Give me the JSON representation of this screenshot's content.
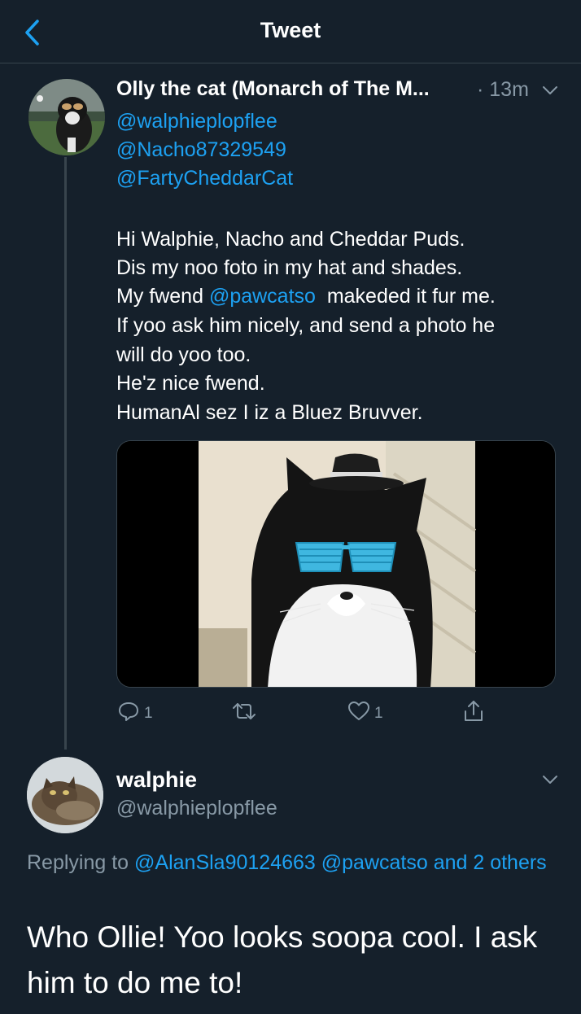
{
  "header": {
    "title": "Tweet"
  },
  "tweet": {
    "author_name": "Olly the cat (Monarch of The M...",
    "time": "· 13m",
    "reply_handles": [
      "@walphieplopflee",
      "@Nacho87329549",
      "@FartyCheddarCat"
    ],
    "body": {
      "line1": "Hi Walphie, Nacho and Cheddar Puds.",
      "line2": "Dis my noo foto in my hat and shades.",
      "line3_before": "My fwend ",
      "line3_mention": "@pawcatso",
      "line3_after": "  makeded it fur me.",
      "line4": "If yoo ask him nicely, and send a photo he",
      "line5": "will do yoo too.",
      "line6": "He'z nice fwend.",
      "line7": "HumanAl sez I iz a Bluez Bruvver."
    },
    "actions": {
      "reply_count": "1",
      "retweet_count": "",
      "like_count": "1"
    }
  },
  "reply": {
    "name": "walphie",
    "handle": "@walphieplopflee",
    "replying_prefix": "Replying to ",
    "replying_mentions": "@AlanSla90124663 @pawcatso and 2 others",
    "text": "Who Ollie! Yoo looks soopa cool. I ask him to do me to!"
  },
  "colors": {
    "background": "#15202b",
    "accent": "#1da1f2",
    "secondary_text": "#8899a6",
    "border": "#38444d"
  },
  "icons": [
    "back-arrow-icon",
    "chevron-down-icon",
    "reply-icon",
    "retweet-icon",
    "like-icon",
    "share-icon"
  ]
}
